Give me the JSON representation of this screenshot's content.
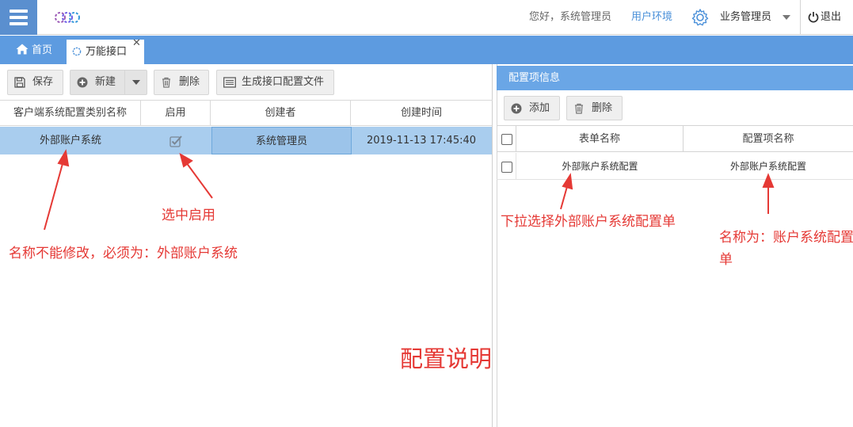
{
  "topbar": {
    "greeting": "您好，系统管理员",
    "user_env": "用户环境",
    "role": "业务管理员",
    "logout": "退出"
  },
  "tabs": [
    {
      "label": "首页",
      "icon": "home-icon"
    },
    {
      "label": "万能接口",
      "icon": "plugin-icon",
      "active": true
    }
  ],
  "left": {
    "toolbar": {
      "save": "保存",
      "new": "新建",
      "delete": "删除",
      "generate": "生成接口配置文件"
    },
    "columns": [
      "客户端系统配置类别名称",
      "启用",
      "创建者",
      "创建时间"
    ],
    "rows": [
      {
        "name": "外部账户系统",
        "enabled": true,
        "creator": "系统管理员",
        "created": "2019-11-13 17:45:40"
      }
    ]
  },
  "right": {
    "title": "配置项信息",
    "toolbar": {
      "add": "添加",
      "delete": "删除"
    },
    "columns": [
      "表单名称",
      "配置项名称"
    ],
    "rows": [
      {
        "form": "外部账户系统配置",
        "item": "外部账户系统配置"
      }
    ]
  },
  "annotations": {
    "select_enable": "选中启用",
    "name_rule": "名称不能修改，必须为：外部账户系统",
    "title": "配置说明",
    "dropdown_rule": "下拉选择外部账户系统配置单",
    "config_name_rule": "名称为：账户系统配置单"
  },
  "colors": {
    "accent": "#5d9be0",
    "header": "#6aa6e6",
    "selected_row": "#a9cdee",
    "annotation": "#e53935"
  }
}
